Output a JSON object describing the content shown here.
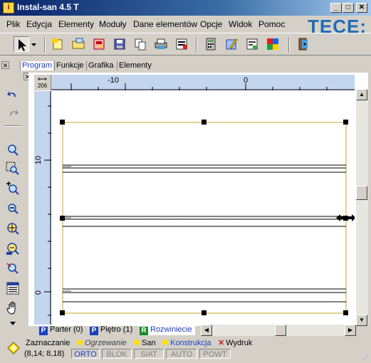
{
  "window": {
    "title": "Instal-san 4.5 T",
    "minimize": "_",
    "maximize": "□",
    "close": "✕"
  },
  "logo": "TECE:",
  "menu": [
    "Plik",
    "Edycja",
    "Elementy",
    "Moduły",
    "Dane elementów",
    "Opcje",
    "Widok",
    "Pomoc"
  ],
  "toolbar": {
    "icons": [
      "select-arrow-icon",
      "dropdown-arrow-icon",
      "new-document-icon",
      "open-folder-icon",
      "print-preview-icon",
      "save-disk-icon",
      "copy-icon",
      "print-icon",
      "export-icon",
      "calculator-icon",
      "edit-properties-icon",
      "report-icon",
      "colors-icon",
      "exit-icon"
    ]
  },
  "tabs_top": [
    "Program",
    "Funkcje",
    "Grafika",
    "Elementy"
  ],
  "left_toolbar": {
    "icons": [
      "undo-icon",
      "redo-icon",
      "zoom-icon",
      "zoom-window-icon",
      "zoom-in-icon",
      "zoom-out-icon",
      "zoom-all-icon",
      "zoom-previous-icon",
      "zoom-realtime-icon",
      "layers-icon",
      "pan-hand-icon",
      "scroll-down-icon"
    ]
  },
  "ruler": {
    "corner_value": "206",
    "x_labels": [
      "-10",
      "0"
    ],
    "y_labels": [
      "10",
      "0"
    ]
  },
  "sheets": [
    {
      "badge": "P",
      "badge_color": "#1c3fbd",
      "label": "Parter (0)"
    },
    {
      "badge": "P",
      "badge_color": "#1c3fbd",
      "label": "Piętro (1)"
    },
    {
      "badge": "R",
      "badge_color": "#1a8a2a",
      "label": "Rozwiniecie"
    }
  ],
  "mode_tabs": [
    {
      "label": "Zaznaczanie",
      "active": true
    },
    {
      "label": "Ogrzewanie",
      "active": false
    },
    {
      "label": "San",
      "active": false
    },
    {
      "label": "Konstrukcja",
      "active": false
    },
    {
      "label": "Wydruk",
      "active": false
    }
  ],
  "status": {
    "coordinates": "(8,14; 8,18)",
    "toggles": [
      "ORTO",
      "BLOK",
      "SIAT",
      "AUTO",
      "POWT"
    ],
    "active_toggle": "ORTO"
  },
  "colors": {
    "title_bar": "#0a246a",
    "ruler": "#c4d6ee",
    "selection_frame": "#c8a020",
    "link_blue": "#1c3fbd"
  }
}
